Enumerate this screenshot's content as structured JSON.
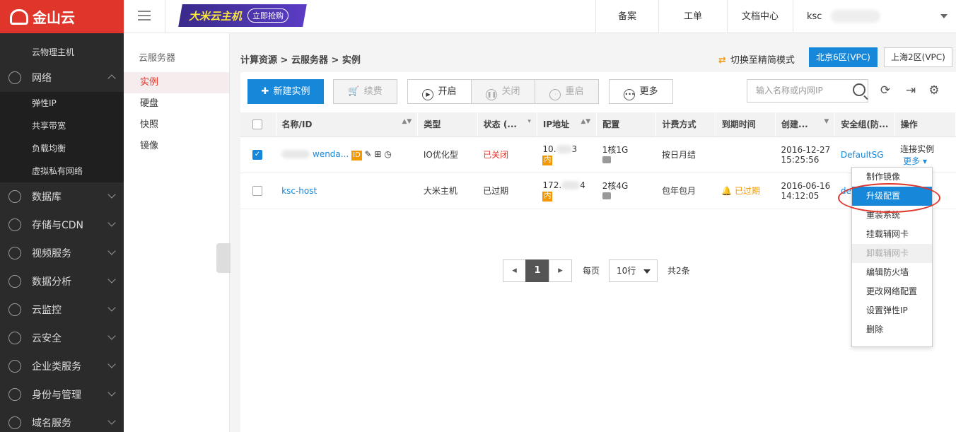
{
  "brand": {
    "name": "金山云"
  },
  "sidebar": {
    "top_sub": "云物理主机",
    "network": {
      "label": "网络",
      "items": [
        "弹性IP",
        "共享带宽",
        "负载均衡",
        "虚拟私有网络"
      ]
    },
    "groups": [
      "数据库",
      "存储与CDN",
      "视频服务",
      "数据分析",
      "云监控",
      "云安全",
      "企业类服务",
      "身份与管理",
      "域名服务"
    ]
  },
  "secnav": {
    "title": "云服务器",
    "items": [
      "实例",
      "硬盘",
      "快照",
      "镜像"
    ]
  },
  "header": {
    "banner_main": "大米云主机",
    "banner_cta": "立即抢购",
    "nav": [
      "备案",
      "工单",
      "文档中心"
    ],
    "user": "ksc"
  },
  "main": {
    "breadcrumb": "计算资源 > 云服务器 > 实例",
    "switch_mode": "切换至精简模式",
    "regions": [
      "北京6区(VPC)",
      "上海2区(VPC)"
    ],
    "toolbar": {
      "create": "新建实例",
      "renew": "续费",
      "start": "开启",
      "stop": "关闭",
      "restart": "重启",
      "more": "更多",
      "search_placeholder": "输入名称或内网IP"
    },
    "table": {
      "headers": [
        "名称/ID",
        "类型",
        "状态 (...",
        "IP地址",
        "配置",
        "计费方式",
        "到期时间",
        "创建...",
        "安全组(防...",
        "操作"
      ],
      "rows": [
        {
          "name": "wenda...",
          "type": "IO优化型",
          "status": "已关闭",
          "ip_prefix": "10.",
          "ip_suffix": "3",
          "ip_tag": "内",
          "config": "1核1G",
          "billing": "按日月结",
          "expire": "",
          "created_date": "2016-12-27",
          "created_time": "15:25:56",
          "sg": "DefaultSG",
          "op1": "连接实例",
          "op2": "更多"
        },
        {
          "name": "ksc-host",
          "type": "大米主机",
          "status": "已过期",
          "ip_prefix": "172.",
          "ip_suffix": "4",
          "ip_tag": "内",
          "config": "2核4G",
          "billing": "包年包月",
          "expire": "已过期",
          "created_date": "2016-06-16",
          "created_time": "14:12:05",
          "sg": "de",
          "op1": "",
          "op2": ""
        }
      ]
    },
    "pager": {
      "current": "1",
      "per_page_label": "每页",
      "per_page": "10行",
      "total": "共2条"
    }
  },
  "dropdown": {
    "items": [
      "制作镜像",
      "升级配置",
      "重装系统",
      "挂载辅网卡",
      "卸载辅网卡",
      "编辑防火墙",
      "更改网络配置",
      "设置弹性IP",
      "删除"
    ],
    "highlighted_index": 1,
    "disabled_index": 4
  },
  "colors": {
    "brand_red": "#e0352b",
    "accent_blue": "#1687d9",
    "warn_orange": "#f39800"
  }
}
